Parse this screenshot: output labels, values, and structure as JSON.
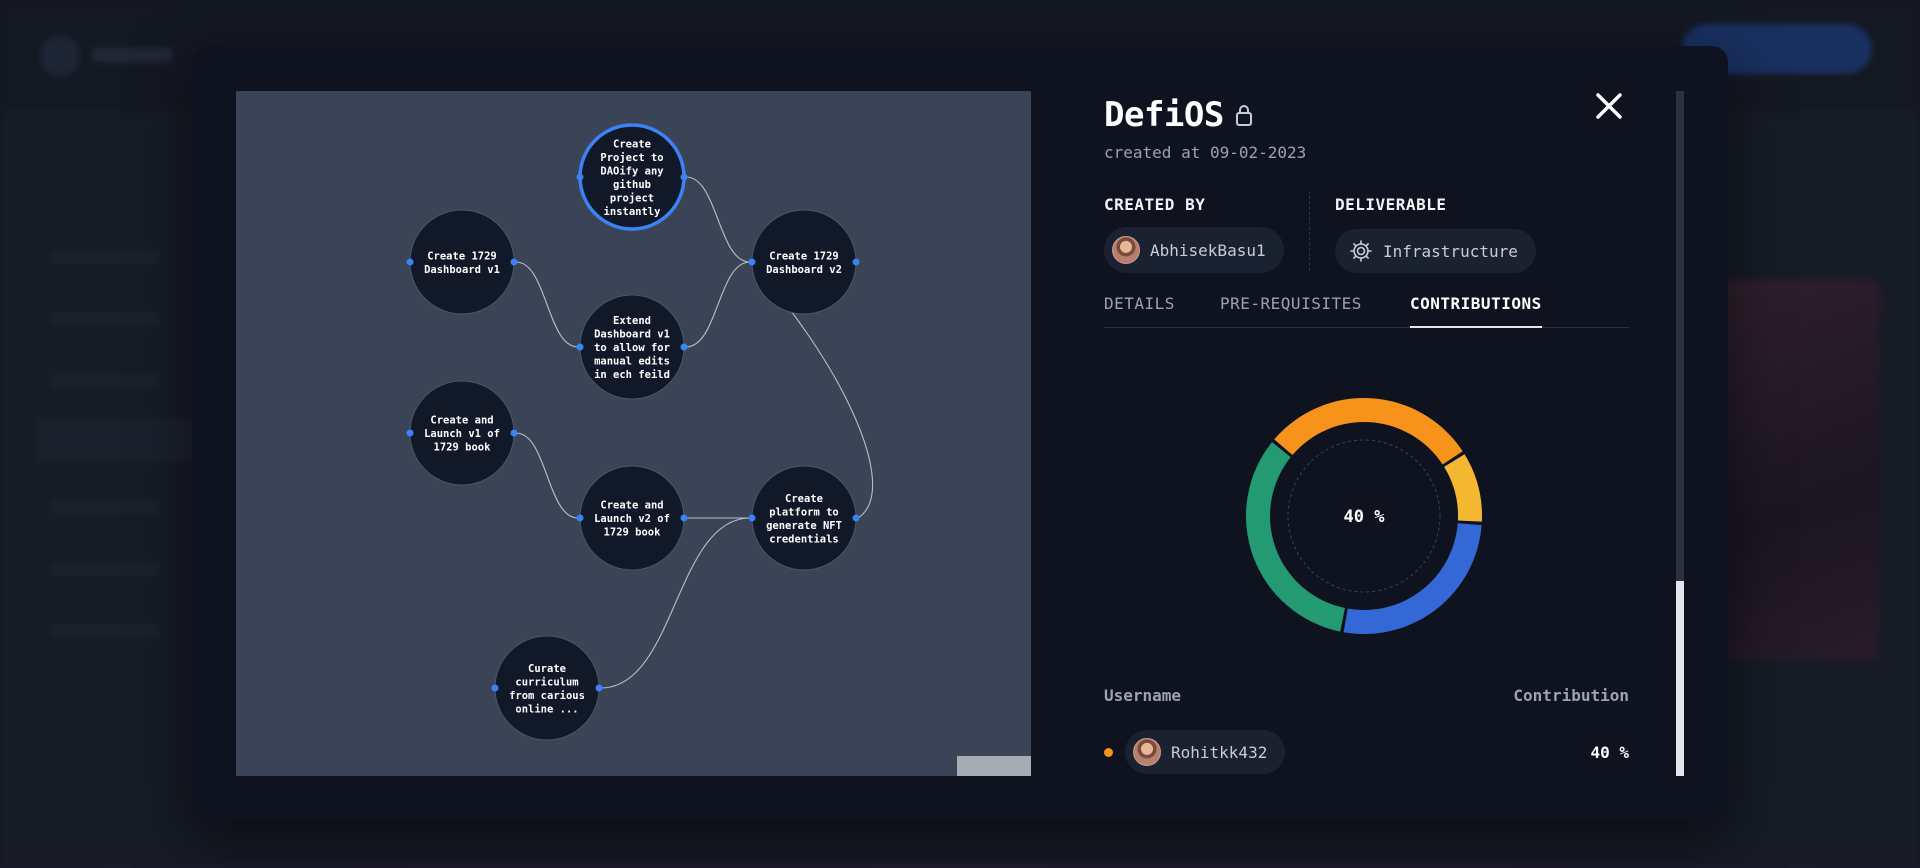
{
  "project": {
    "title": "DefiOS",
    "created_at": "created at 09-02-2023"
  },
  "meta": {
    "created_by_label": "CREATED BY",
    "creator": "AbhisekBasu1",
    "deliverable_label": "DELIVERABLE",
    "deliverable": "Infrastructure"
  },
  "tabs": [
    {
      "label": "DETAILS",
      "active": false
    },
    {
      "label": "PRE-REQUISITES",
      "active": false
    },
    {
      "label": "CONTRIBUTIONS",
      "active": true
    }
  ],
  "graph": {
    "nodes": [
      {
        "id": "n1",
        "lines": [
          "Create",
          "Project to",
          "DAOify any",
          "github",
          "project",
          "instantly"
        ],
        "highlighted": true
      },
      {
        "id": "n2",
        "lines": [
          "Create 1729",
          "Dashboard v1"
        ],
        "highlighted": false
      },
      {
        "id": "n3",
        "lines": [
          "Create 1729",
          "Dashboard v2"
        ],
        "highlighted": false
      },
      {
        "id": "n4",
        "lines": [
          "Extend",
          "Dashboard v1",
          "to allow for",
          "manual edits",
          "in ech feild"
        ],
        "highlighted": false
      },
      {
        "id": "n5",
        "lines": [
          "Create and",
          "Launch v1 of",
          "1729 book"
        ],
        "highlighted": false
      },
      {
        "id": "n6",
        "lines": [
          "Create and",
          "Launch v2 of",
          "1729 book"
        ],
        "highlighted": false
      },
      {
        "id": "n7",
        "lines": [
          "Create",
          "platform to",
          "generate NFT",
          "credentials"
        ],
        "highlighted": false
      },
      {
        "id": "n8",
        "lines": [
          "Curate",
          "curriculum",
          "from carious",
          "online ..."
        ],
        "highlighted": false
      }
    ],
    "edges": [
      [
        "n1",
        "n3"
      ],
      [
        "n2",
        "n4"
      ],
      [
        "n4",
        "n3"
      ],
      [
        "n3",
        "n7"
      ],
      [
        "n5",
        "n6"
      ],
      [
        "n6",
        "n7"
      ],
      [
        "n8",
        "n7"
      ]
    ]
  },
  "contributions": {
    "center_label": "40 %",
    "segments": [
      {
        "value": 30,
        "color": "#f7931a"
      },
      {
        "value": 10,
        "color": "#f4b731"
      },
      {
        "value": 27,
        "color": "#3368d6"
      },
      {
        "value": 33,
        "color": "#249a72"
      }
    ],
    "header_username": "Username",
    "header_contribution": "Contribution",
    "rows": [
      {
        "username": "Rohitkk432",
        "value": "40 %",
        "color": "#f7931a"
      }
    ]
  },
  "icons": {
    "lock": "lock-icon",
    "close": "close-icon",
    "deliverable": "gear-icon"
  }
}
